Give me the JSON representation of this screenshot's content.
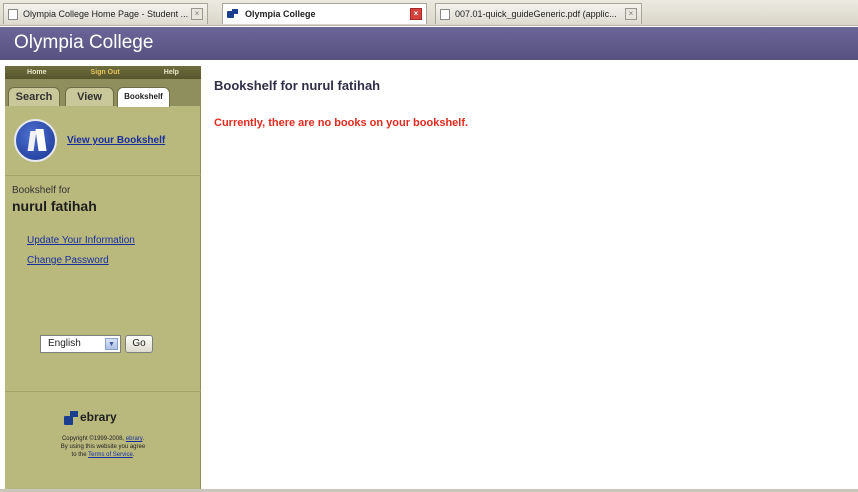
{
  "browser": {
    "tabs": [
      {
        "title": "Olympia College Home Page - Student ...",
        "active": false
      },
      {
        "title": "Olympia College",
        "active": true
      },
      {
        "title": "007.01-quick_guideGeneric.pdf (applic...",
        "active": false
      }
    ]
  },
  "header": {
    "title": "Olympia College"
  },
  "sidebar": {
    "topnav": {
      "home": "Home",
      "sign_out": "Sign Out",
      "help": "Help"
    },
    "tabs": {
      "search": "Search",
      "view": "View",
      "bookshelf": "Bookshelf"
    },
    "view_bookshelf_link": "View your Bookshelf",
    "bookshelf_for_label": "Bookshelf for",
    "user_name": "nurul fatihah",
    "links": {
      "update_info": "Update Your Information",
      "change_password": "Change Password"
    },
    "language": {
      "selected": "English",
      "go_label": "Go"
    },
    "footer": {
      "brand": "ebrary",
      "copyright_prefix": "Copyright ©1999-2008,",
      "copyright_link": "ebrary",
      "agree_text": "By using this website you agree",
      "terms_prefix": "to the",
      "terms_link": "Terms of Service"
    }
  },
  "main": {
    "title": "Bookshelf for nurul fatihah",
    "empty_message": "Currently, there are no books on your bookshelf."
  },
  "colors": {
    "header_bg": "#5e5a8a",
    "sidebar_bg": "#b9b97e",
    "link": "#1a2f9c",
    "alert": "#e32a1e"
  }
}
